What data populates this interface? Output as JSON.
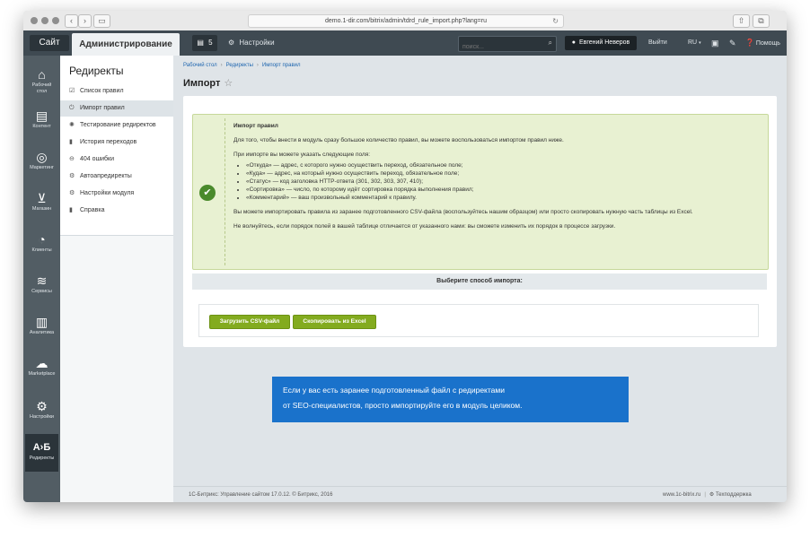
{
  "browser": {
    "url": "demo.1-dir.com/bitrix/admin/tdrd_rule_import.php?lang=ru"
  },
  "topbar": {
    "site_label": "Сайт",
    "admin_label": "Администрирование",
    "notifications_count": "5",
    "settings_label": "Настройки",
    "search_placeholder": "поиск...",
    "user_name": "Евгений Неверов",
    "logout_label": "Выйти",
    "lang_label": "RU",
    "help_label": "Помощь"
  },
  "sidebar": {
    "items": [
      {
        "label": "Рабочий стол",
        "icon": "home-icon"
      },
      {
        "label": "Контент",
        "icon": "document-icon"
      },
      {
        "label": "Маркетинг",
        "icon": "target-icon"
      },
      {
        "label": "Магазин",
        "icon": "cart-icon"
      },
      {
        "label": "Клиенты",
        "icon": "clock-24-icon"
      },
      {
        "label": "Сервисы",
        "icon": "layers-icon"
      },
      {
        "label": "Аналитика",
        "icon": "bar-chart-icon"
      },
      {
        "label": "Marketplace",
        "icon": "cloud-download-icon"
      },
      {
        "label": "Настройки",
        "icon": "gear-icon"
      },
      {
        "label": "Редиректы",
        "icon": "ab-redirect-icon",
        "glyph": "A›Б"
      }
    ]
  },
  "menu": {
    "title": "Редиректы",
    "items": [
      {
        "label": "Список правил"
      },
      {
        "label": "Импорт правил"
      },
      {
        "label": "Тестирование редиректов"
      },
      {
        "label": "История переходов"
      },
      {
        "label": "404 ошибки"
      },
      {
        "label": "Автоапредиректы"
      },
      {
        "label": "Настройки модуля"
      },
      {
        "label": "Справка"
      }
    ]
  },
  "breadcrumbs": [
    "Рабочий стол",
    "Редиректы",
    "Импорт правил"
  ],
  "page": {
    "title": "Импорт",
    "note": {
      "heading": "Импорт правил",
      "intro": "Для того, чтобы внести в модуль сразу большое количество правил, вы можете воспользоваться импортом правил ниже.",
      "fields_intro": "При импорте вы можете указать следующие поля:",
      "fields": [
        "«Откуда» — адрес, с которого нужно осуществить переход, обязательное поле;",
        "«Куда» — адрес, на который нужно осуществить переход, обязательное поле;",
        "«Статус» — код заголовка HTTP-ответа (301, 302, 303, 307, 410);",
        "«Сортировка» — число, по которому идёт сортировка порядка выполнения правил;",
        "«Комментарий» — ваш произвольный комментарий к правилу."
      ],
      "csv_text": "Вы можете импортировать правила из заранее подготовленного CSV-файла (воспользуйтесь нашим образцом) или просто скопировать нужную часть таблицы из Excel.",
      "order_text": "Не волнуйтесь, если порядок полей в вашей таблице отличается от указанного нами: вы сможете изменить их порядок в процессе загрузки."
    },
    "choose_label": "Выберите способ импорта:",
    "buttons": {
      "upload_csv": "Загрузить CSV-файл",
      "copy_excel": "Скопировать из Excel"
    }
  },
  "tooltip": {
    "line1": "Если у вас есть заранее подготовленный файл с редиректами",
    "line2": "от SEO-специалистов, просто импортируйте его в модуль целиком."
  },
  "footer": {
    "copyright": "1С-Битрикс: Управление сайтом 17.0.12. © Битрикс, 2016",
    "site_link": "www.1c-bitrix.ru",
    "support": "Техподдержка"
  },
  "colors": {
    "topbar": "#3f4a52",
    "sidebar": "#525d64",
    "note_bg": "#e8f1d2",
    "button_green": "#83ab1f",
    "tooltip_blue": "#1a72cb"
  }
}
